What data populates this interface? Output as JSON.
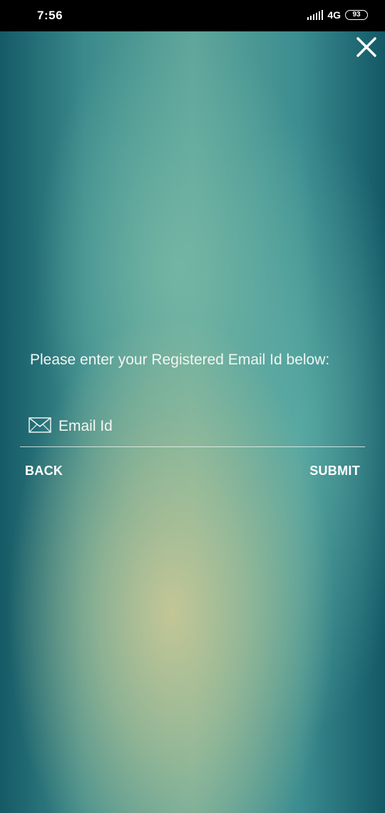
{
  "status_bar": {
    "time": "7:56",
    "network_type": "4G",
    "battery_level": "93"
  },
  "dialog": {
    "close_icon": "close-icon",
    "prompt": "Please enter your Registered Email Id below:",
    "email_field": {
      "icon": "mail-icon",
      "placeholder": "Email Id",
      "value": ""
    },
    "back_label": "BACK",
    "submit_label": "SUBMIT"
  },
  "colors": {
    "status_bar_bg": "#000000",
    "text": "#ffffff",
    "background_edge": "#155a66",
    "background_center": "#5fa59a",
    "background_glow": "#c8c896"
  }
}
